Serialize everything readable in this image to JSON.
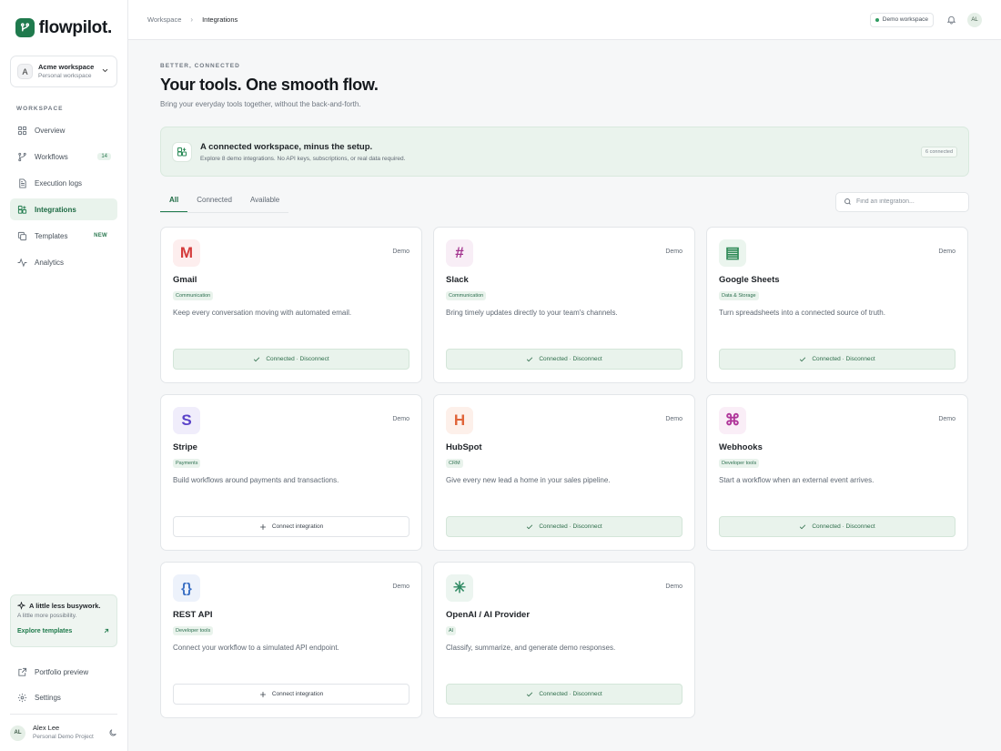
{
  "brand": {
    "name": "flowpilot."
  },
  "workspace": {
    "avatar": "A",
    "name": "Acme workspace",
    "subtitle": "Personal workspace"
  },
  "sidebar": {
    "section_label": "WORKSPACE",
    "items": [
      {
        "label": "Overview",
        "icon": "grid-icon",
        "badge": ""
      },
      {
        "label": "Workflows",
        "icon": "branch-icon",
        "badge": "14"
      },
      {
        "label": "Execution logs",
        "icon": "document-icon",
        "badge": ""
      },
      {
        "label": "Integrations",
        "icon": "puzzle-icon",
        "badge": "",
        "active": true
      },
      {
        "label": "Templates",
        "icon": "copy-icon",
        "badge": "NEW"
      },
      {
        "label": "Analytics",
        "icon": "activity-icon",
        "badge": ""
      }
    ],
    "promo": {
      "title": "A little less busywork.",
      "subtitle": "A little more possibility.",
      "link": "Explore templates"
    },
    "bottom_items": [
      {
        "label": "Portfolio preview",
        "icon": "external-link-icon"
      },
      {
        "label": "Settings",
        "icon": "gear-icon"
      }
    ],
    "user": {
      "initials": "AL",
      "name": "Alex Lee",
      "subtitle": "Personal Demo Project"
    }
  },
  "topbar": {
    "breadcrumb": [
      "Workspace",
      "Integrations"
    ],
    "workspace_pill": "Demo workspace",
    "avatar": "AL"
  },
  "page": {
    "eyebrow": "BETTER, CONNECTED",
    "title": "Your tools. One smooth flow.",
    "subtitle": "Bring your everyday tools together, without the back-and-forth."
  },
  "banner": {
    "title": "A connected workspace, minus the setup.",
    "subtitle": "Explore 8 demo integrations. No API keys, subscriptions, or real data required.",
    "count": "6 connected"
  },
  "tabs": [
    "All",
    "Connected",
    "Available"
  ],
  "search": {
    "placeholder": "Find an integration..."
  },
  "integrations": [
    {
      "name": "Gmail",
      "glyph": "M",
      "color": "#d43b3b",
      "bg": "#fdeeee",
      "category": "Communication",
      "description": "Keep every conversation moving with automated email.",
      "tag": "Demo",
      "status": "connected",
      "action": "Connected · Disconnect"
    },
    {
      "name": "Slack",
      "glyph": "#",
      "color": "#a3358f",
      "bg": "#f8eef6",
      "category": "Communication",
      "description": "Bring timely updates directly to your team's channels.",
      "tag": "Demo",
      "status": "connected",
      "action": "Connected · Disconnect"
    },
    {
      "name": "Google Sheets",
      "glyph": "▤",
      "color": "#2f8a57",
      "bg": "#ebf5ee",
      "category": "Data & Storage",
      "description": "Turn spreadsheets into a connected source of truth.",
      "tag": "Demo",
      "status": "connected",
      "action": "Connected · Disconnect"
    },
    {
      "name": "Stripe",
      "glyph": "S",
      "color": "#5b43c9",
      "bg": "#f0edfb",
      "category": "Payments",
      "description": "Build workflows around payments and transactions.",
      "tag": "Demo",
      "status": "available",
      "action": "Connect integration"
    },
    {
      "name": "HubSpot",
      "glyph": "H",
      "color": "#e0653a",
      "bg": "#fdf0ea",
      "category": "CRM",
      "description": "Give every new lead a home in your sales pipeline.",
      "tag": "Demo",
      "status": "connected",
      "action": "Connected · Disconnect"
    },
    {
      "name": "Webhooks",
      "glyph": "⌘",
      "color": "#b0369a",
      "bg": "#faeef7",
      "category": "Developer tools",
      "description": "Start a workflow when an external event arrives.",
      "tag": "Demo",
      "status": "connected",
      "action": "Connected · Disconnect"
    },
    {
      "name": "REST API",
      "glyph": "{}",
      "color": "#3a6fc4",
      "bg": "#edf2fb",
      "category": "Developer tools",
      "description": "Connect your workflow to a simulated API endpoint.",
      "tag": "Demo",
      "status": "available",
      "action": "Connect integration"
    },
    {
      "name": "OpenAI / AI Provider",
      "glyph": "✳",
      "color": "#2f8a63",
      "bg": "#ecf5f0",
      "category": "AI",
      "description": "Classify, summarize, and generate demo responses.",
      "tag": "Demo",
      "status": "connected",
      "action": "Connected · Disconnect"
    }
  ]
}
